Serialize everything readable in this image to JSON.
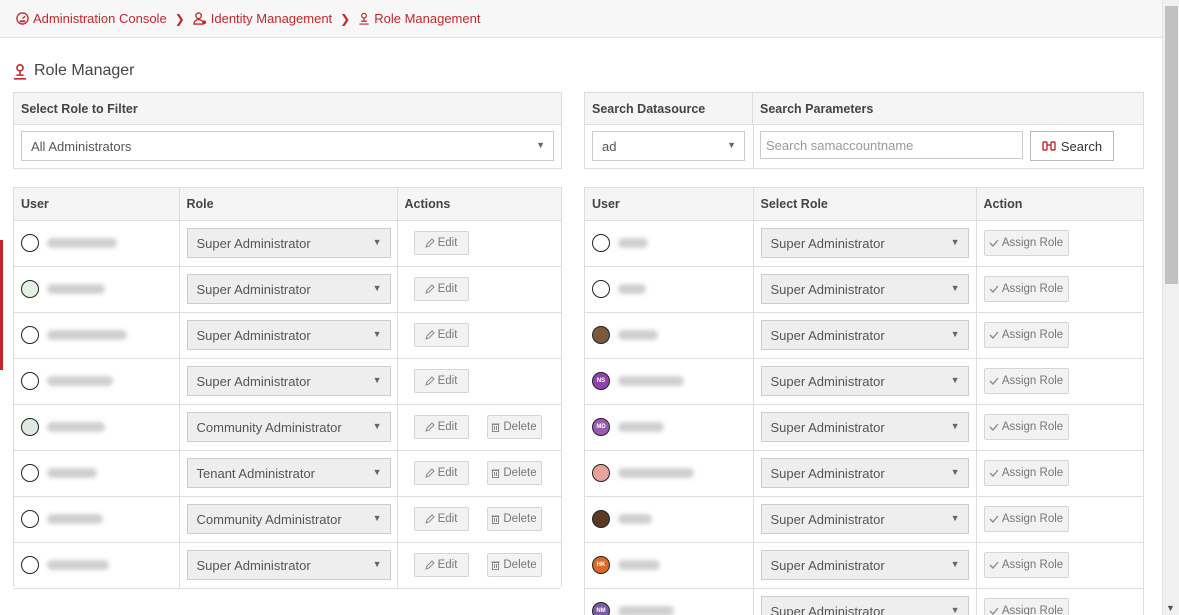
{
  "breadcrumb": [
    {
      "label": "Administration Console",
      "icon": "dashboard-icon"
    },
    {
      "label": "Identity Management",
      "icon": "user-gear-icon"
    },
    {
      "label": "Role Management",
      "icon": "role-icon"
    }
  ],
  "page_title": "Role Manager",
  "filter": {
    "header": "Select Role to Filter",
    "value": "All Administrators"
  },
  "search": {
    "datasource_header": "Search Datasource",
    "params_header": "Search Parameters",
    "datasource_value": "ad",
    "placeholder": "Search samaccountname",
    "button_label": "Search"
  },
  "left_table": {
    "columns": [
      "User",
      "Role",
      "Actions"
    ],
    "edit_label": "Edit",
    "delete_label": "Delete",
    "rows": [
      {
        "role": "Super Administrator",
        "delete": false
      },
      {
        "role": "Super Administrator",
        "delete": false
      },
      {
        "role": "Super Administrator",
        "delete": false
      },
      {
        "role": "Super Administrator",
        "delete": false
      },
      {
        "role": "Community Administrator",
        "delete": true
      },
      {
        "role": "Tenant Administrator",
        "delete": true
      },
      {
        "role": "Community Administrator",
        "delete": true
      },
      {
        "role": "Super Administrator",
        "delete": true
      }
    ]
  },
  "right_table": {
    "columns": [
      "User",
      "Select Role",
      "Action"
    ],
    "assign_label": "Assign Role",
    "rows": [
      {
        "role": "Super Administrator",
        "initials": ""
      },
      {
        "role": "Super Administrator",
        "initials": ""
      },
      {
        "role": "Super Administrator",
        "initials": ""
      },
      {
        "role": "Super Administrator",
        "initials": "NS"
      },
      {
        "role": "Super Administrator",
        "initials": "MD"
      },
      {
        "role": "Super Administrator",
        "initials": ""
      },
      {
        "role": "Super Administrator",
        "initials": ""
      },
      {
        "role": "Super Administrator",
        "initials": "HK"
      },
      {
        "role": "Super Administrator",
        "initials": "NM"
      }
    ]
  },
  "colors": {
    "accent": "#c0272d"
  }
}
